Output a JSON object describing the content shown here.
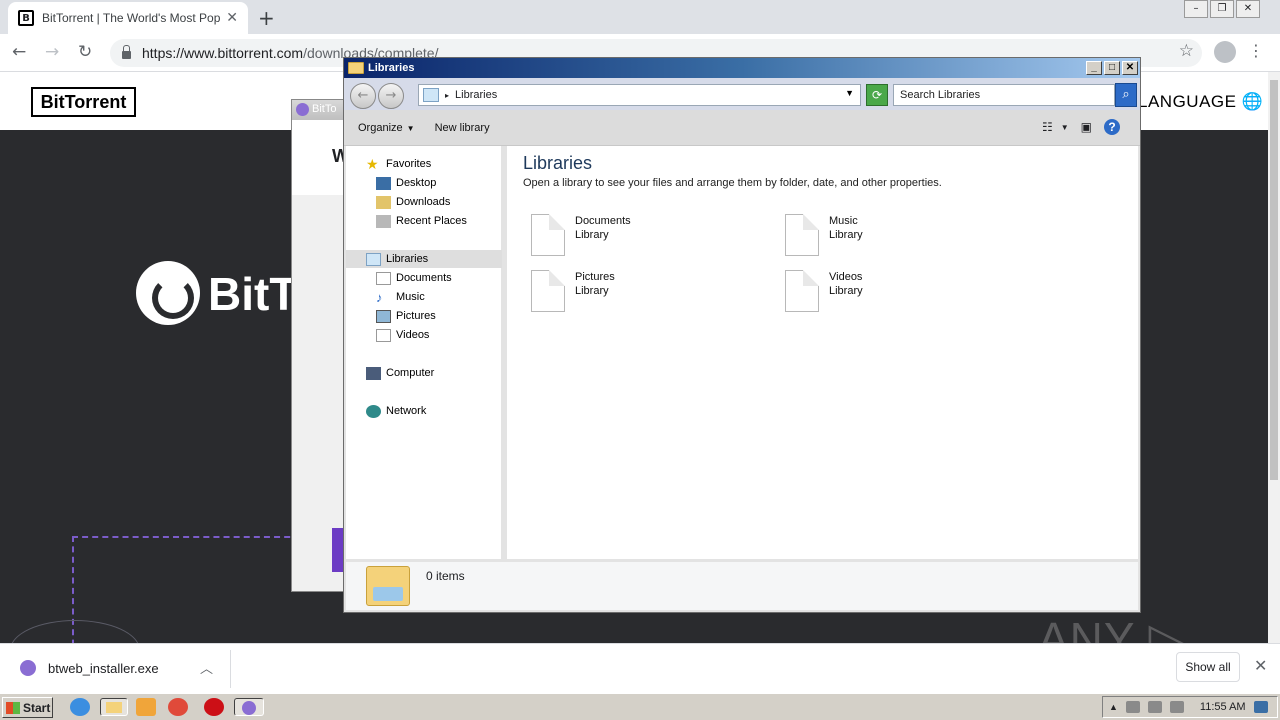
{
  "browser": {
    "tab_title": "BitTorrent | The World's Most Popular",
    "tab_favicon": "B",
    "new_tab_glyph": "+",
    "close_glyph": "✕",
    "url_host": "https://www.bittorrent.com",
    "url_path": "/downloads/complete/"
  },
  "site": {
    "logo": "BitTorrent",
    "language": "LANGUAGE 🌐",
    "hero_text": "BitT"
  },
  "background_window": {
    "title": "BitTo",
    "heading_fragment": "W"
  },
  "explorer": {
    "title": "Libraries",
    "address": "Libraries",
    "search_placeholder": "Search Libraries",
    "commands": {
      "organize": "Organize",
      "new_library": "New library"
    },
    "nav": {
      "favorites": "Favorites",
      "desktop": "Desktop",
      "downloads": "Downloads",
      "recent": "Recent Places",
      "libraries": "Libraries",
      "documents": "Documents",
      "music": "Music",
      "pictures": "Pictures",
      "videos": "Videos",
      "computer": "Computer",
      "network": "Network"
    },
    "heading": "Libraries",
    "subheading": "Open a library to see your files and arrange them by folder, date, and other properties.",
    "libraries": [
      {
        "name": "Documents",
        "type": "Library"
      },
      {
        "name": "Music",
        "type": "Library"
      },
      {
        "name": "Pictures",
        "type": "Library"
      },
      {
        "name": "Videos",
        "type": "Library"
      }
    ],
    "status": "0 items"
  },
  "downloads_bar": {
    "file": "btweb_installer.exe",
    "show_all": "Show all"
  },
  "watermark": "ANY ▷ RUN",
  "taskbar": {
    "start": "Start",
    "clock": "11:55 AM"
  },
  "colors": {
    "hero_bg": "#2a2b2e",
    "explorer_title_start": "#0a246a",
    "accent_purple": "#6c3cc4"
  }
}
